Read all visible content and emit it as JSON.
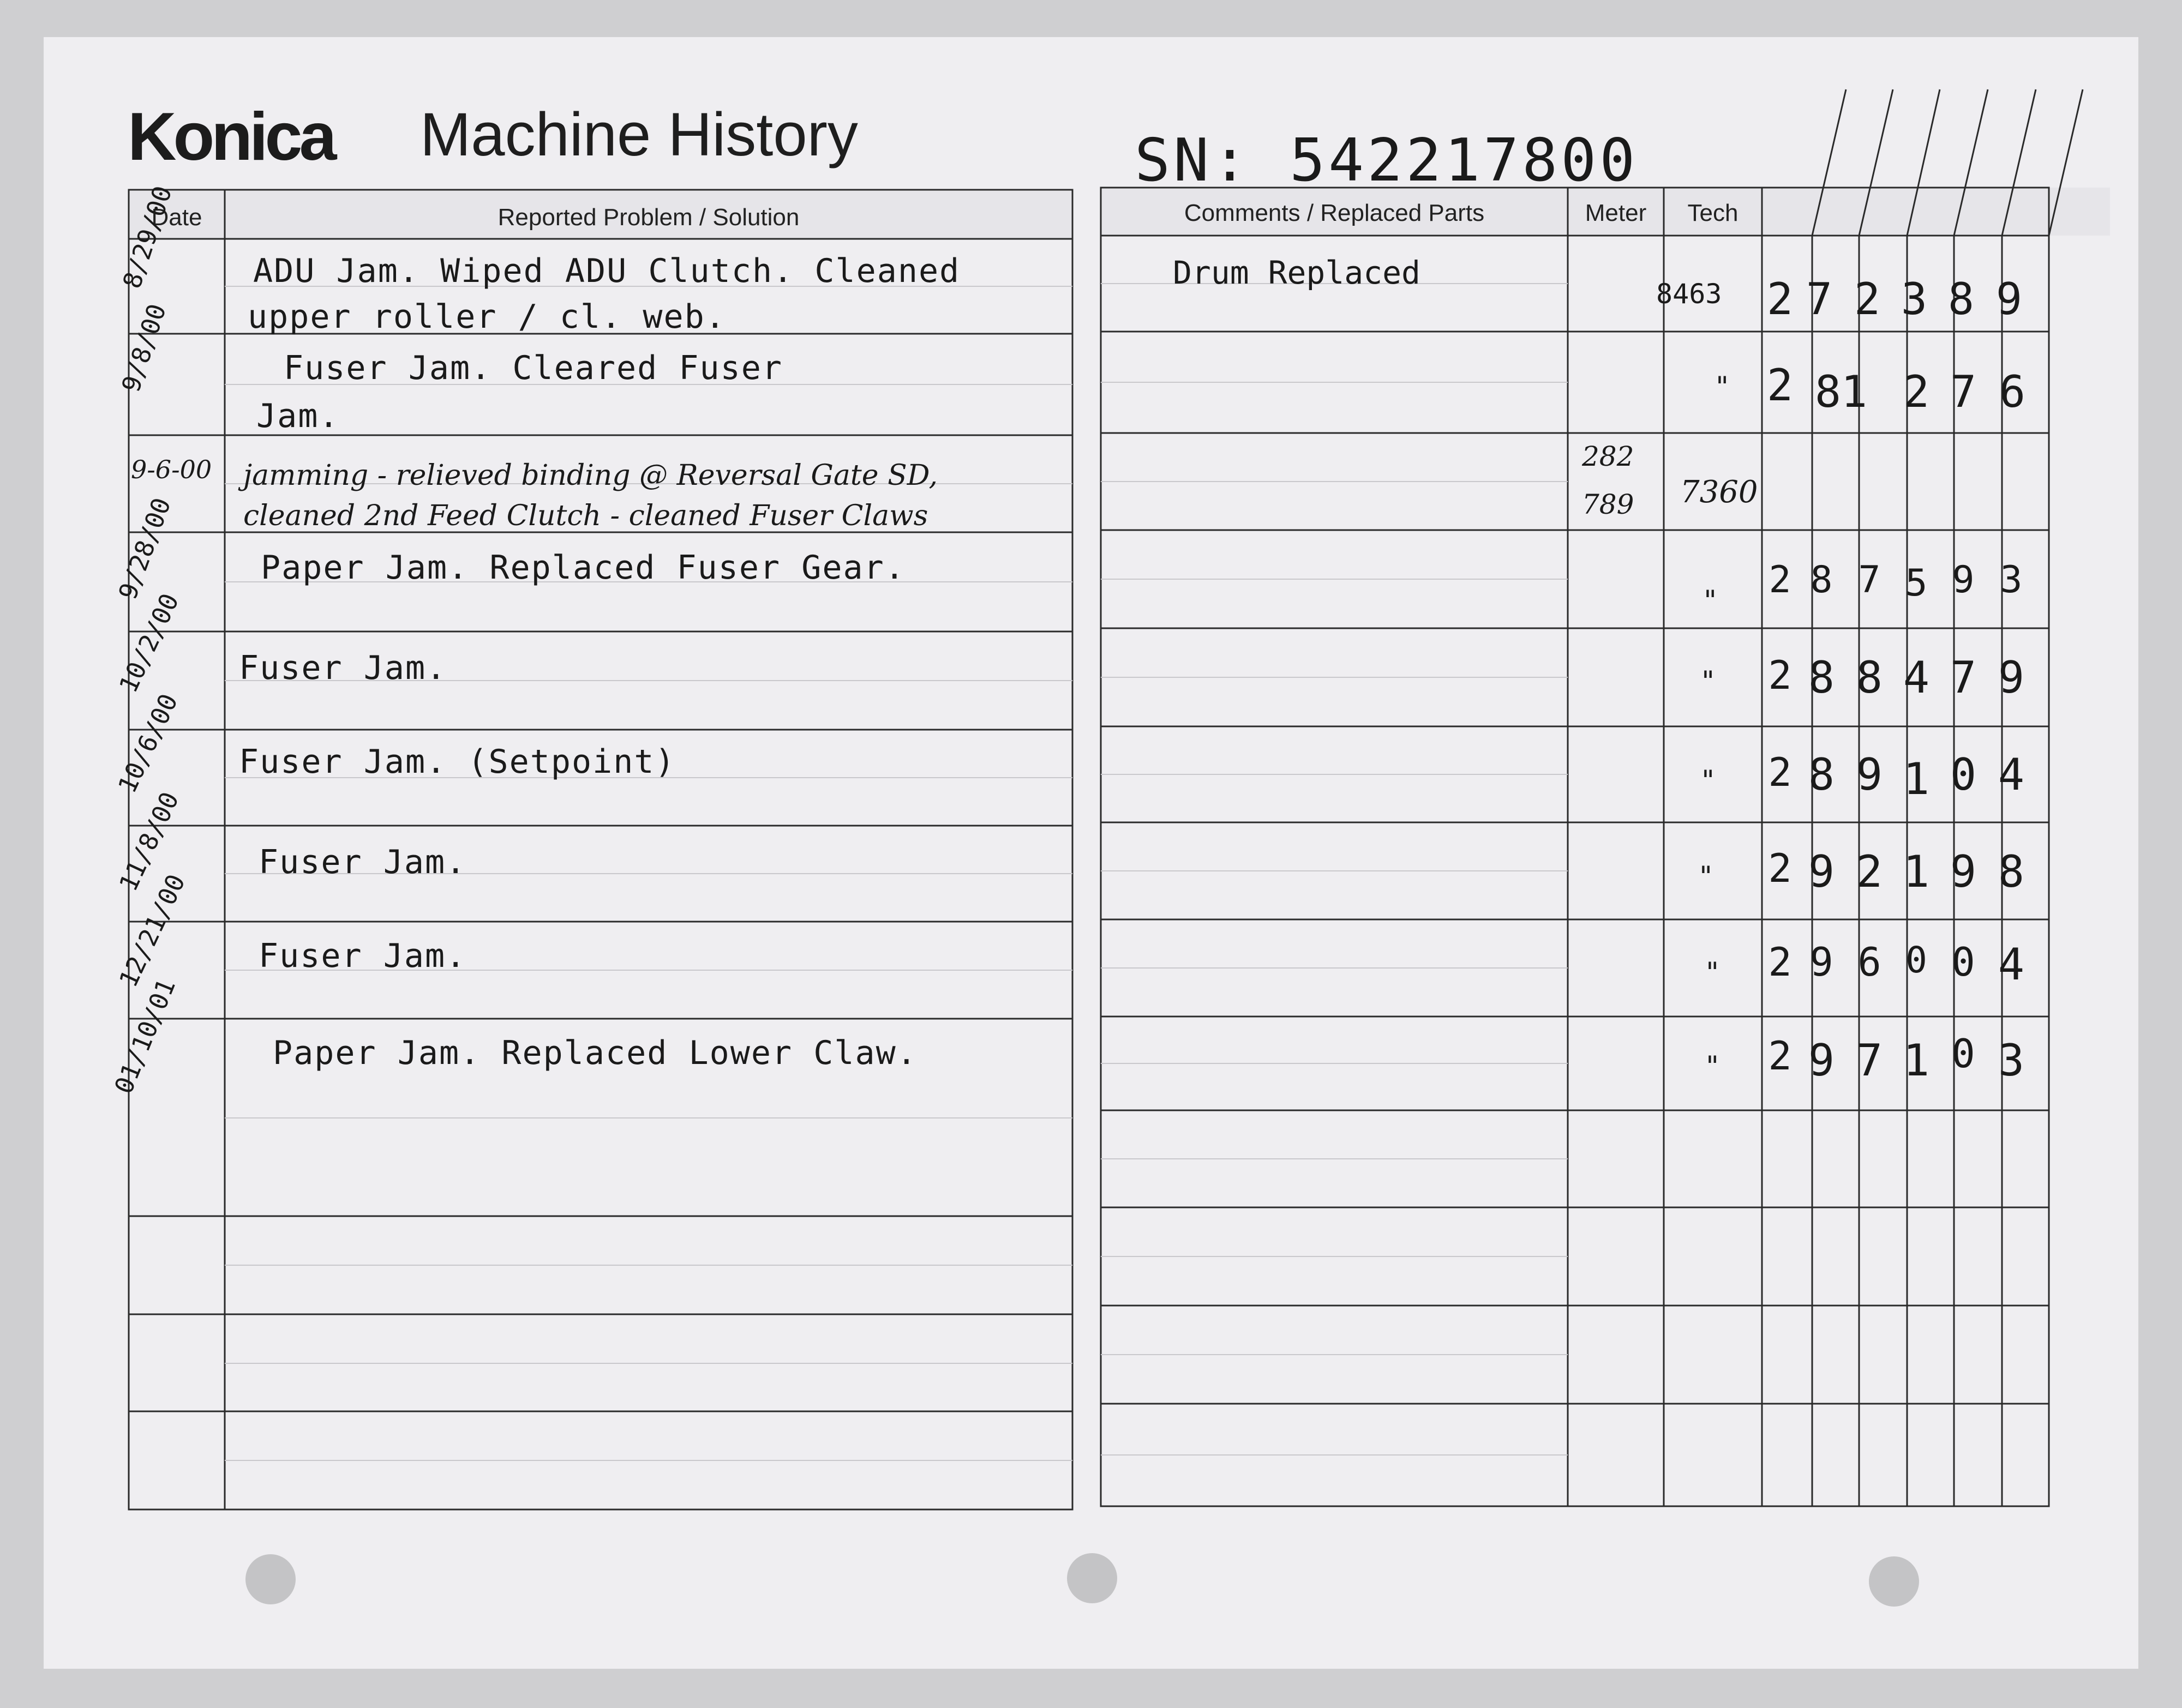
{
  "header": {
    "logo": "Konica",
    "title": "Machine History",
    "serial": "SN: 542217800"
  },
  "columns": {
    "date": "Date",
    "problem": "Reported Problem / Solution",
    "comments": "Comments / Replaced Parts",
    "meter": "Meter",
    "tech": "Tech"
  },
  "entries": [
    {
      "date": "8/29/00",
      "problem": [
        "ADU Jam. Wiped ADU Clutch. Cleaned",
        "upper roller / cl. web."
      ],
      "comments": "Drum Replaced",
      "meter": "",
      "tech": "8463",
      "reading": [
        "2",
        "7",
        "2",
        "3",
        "8",
        "9"
      ]
    },
    {
      "date": "9/8/00",
      "problem": [
        "Fuser Jam. Cleared Fuser",
        "Jam."
      ],
      "comments": "",
      "meter": "",
      "tech": "\"",
      "reading": [
        "2",
        "8",
        "1",
        "2",
        "7",
        "6"
      ]
    },
    {
      "date": "9-6-00",
      "problem": [
        "jamming - relieved binding @ Reversal Gate SD,",
        "cleaned 2nd Feed Clutch - cleaned Fuser Claws"
      ],
      "comments": "",
      "meter": [
        "282",
        "789"
      ],
      "tech": "7360",
      "reading": [
        "",
        "",
        "",
        "",
        "",
        ""
      ]
    },
    {
      "date": "9/28/00",
      "problem": [
        "Paper Jam. Replaced Fuser Gear."
      ],
      "comments": "",
      "meter": "",
      "tech": "\"",
      "reading": [
        "2",
        "8",
        "7",
        "5",
        "9",
        "3"
      ]
    },
    {
      "date": "10/2/00",
      "problem": [
        "Fuser Jam."
      ],
      "comments": "",
      "meter": "",
      "tech": "\"",
      "reading": [
        "2",
        "8",
        "8",
        "4",
        "7",
        "9"
      ]
    },
    {
      "date": "10/6/00",
      "problem": [
        "Fuser Jam. (Setpoint)"
      ],
      "comments": "",
      "meter": "",
      "tech": "\"",
      "reading": [
        "2",
        "8",
        "9",
        "1",
        "0",
        "4"
      ]
    },
    {
      "date": "11/8/00",
      "problem": [
        "Fuser Jam."
      ],
      "comments": "",
      "meter": "",
      "tech": "\"",
      "reading": [
        "2",
        "9",
        "2",
        "1",
        "9",
        "8"
      ]
    },
    {
      "date": "12/21/00",
      "problem": [
        "Fuser Jam."
      ],
      "comments": "",
      "meter": "",
      "tech": "\"",
      "reading": [
        "2",
        "9",
        "6",
        "0",
        "0",
        "4"
      ]
    },
    {
      "date": "01/10/01",
      "problem": [
        "Paper Jam. Replaced Lower Claw."
      ],
      "comments": "",
      "meter": "",
      "tech": "\"",
      "reading": [
        "2",
        "9",
        "7",
        "1",
        "0",
        "3"
      ]
    }
  ]
}
